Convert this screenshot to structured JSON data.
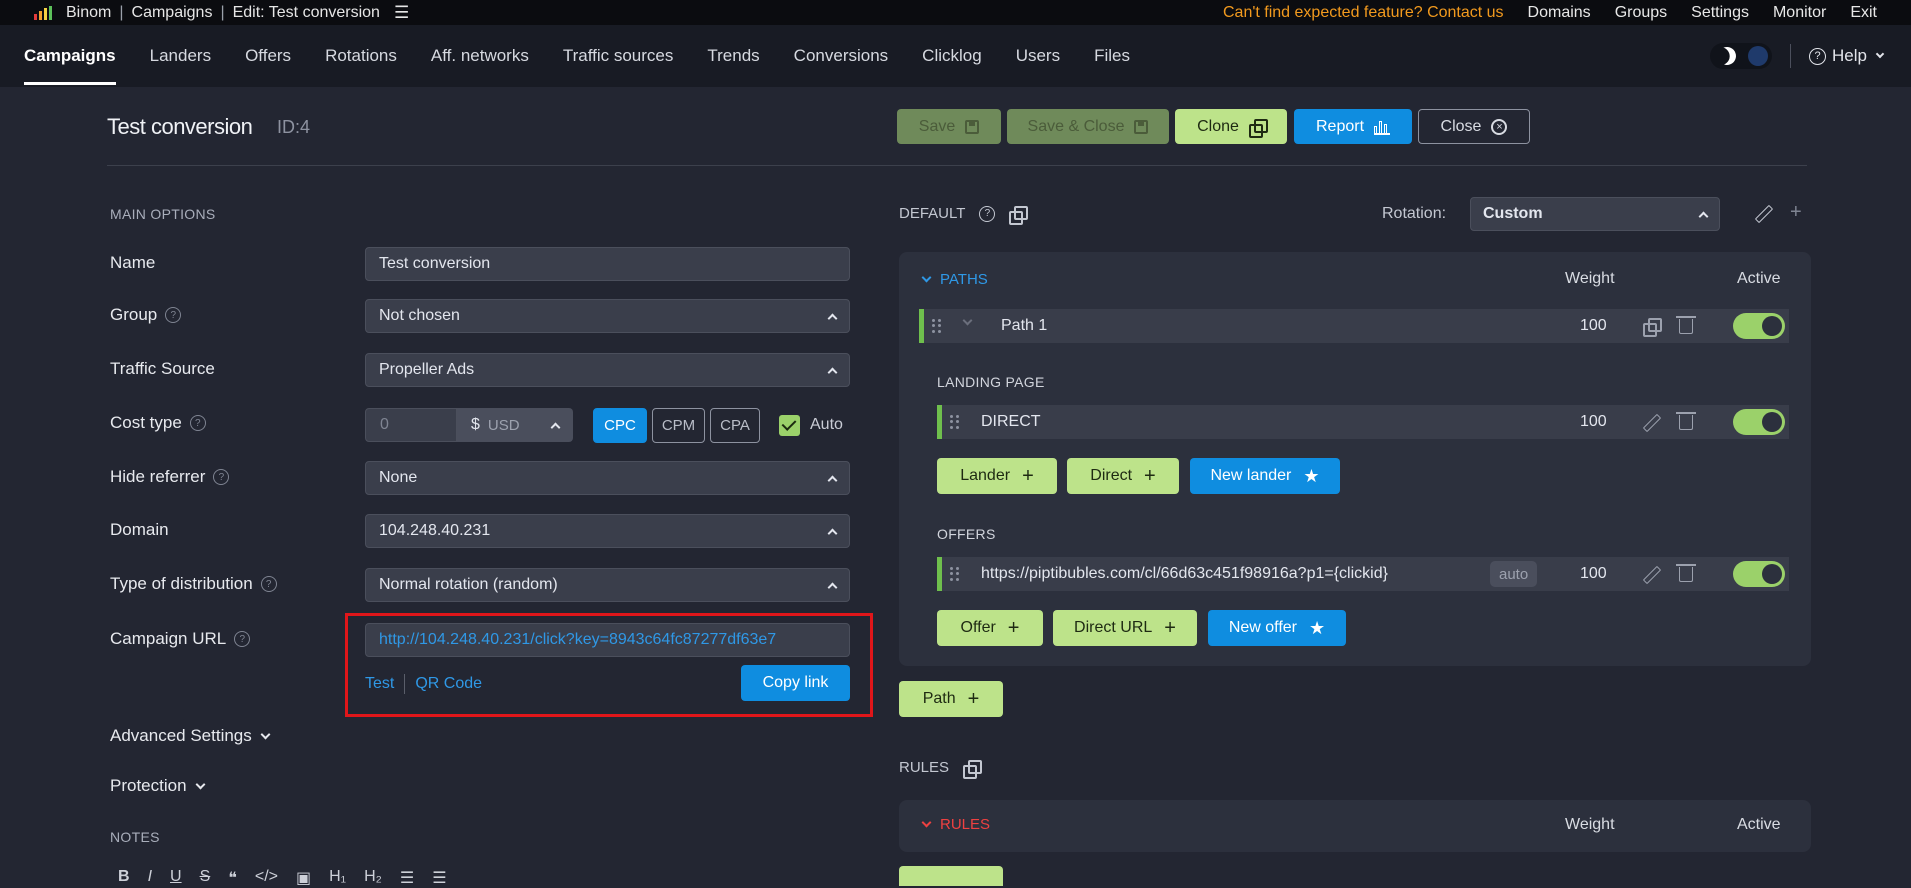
{
  "topbar": {
    "brand": "Binom",
    "crumb_1": "Campaigns",
    "crumb_2": "Edit: Test conversion",
    "contact": "Can't find expected feature? Contact us",
    "links": [
      "Domains",
      "Groups",
      "Settings",
      "Monitor",
      "Exit"
    ]
  },
  "nav": {
    "items": [
      "Campaigns",
      "Landers",
      "Offers",
      "Rotations",
      "Aff. networks",
      "Traffic sources",
      "Trends",
      "Conversions",
      "Clicklog",
      "Users",
      "Files"
    ],
    "help": "Help"
  },
  "page": {
    "title": "Test conversion",
    "id": "ID:4"
  },
  "actions": {
    "save": "Save",
    "save_close": "Save & Close",
    "clone": "Clone",
    "report": "Report",
    "close": "Close"
  },
  "main_options": {
    "heading": "MAIN OPTIONS",
    "name_label": "Name",
    "name_value": "Test conversion",
    "group_label": "Group",
    "group_value": "Not chosen",
    "traffic_label": "Traffic Source",
    "traffic_value": "Propeller Ads",
    "cost_label": "Cost type",
    "cost_value": "0",
    "currency_symbol": "$",
    "currency": "USD",
    "cost_models": [
      "CPC",
      "CPM",
      "CPA"
    ],
    "auto_label": "Auto",
    "referrer_label": "Hide referrer",
    "referrer_value": "None",
    "domain_label": "Domain",
    "domain_value": "104.248.40.231",
    "distribution_label": "Type of distribution",
    "distribution_value": "Normal rotation (random)",
    "url_label": "Campaign URL",
    "url_value": "http://104.248.40.231/click?key=8943c64fc87277df63e7",
    "test_link": "Test",
    "qr_link": "QR Code",
    "copy_link": "Copy link",
    "advanced": "Advanced Settings",
    "protection": "Protection",
    "notes": "NOTES"
  },
  "default_section": {
    "heading": "DEFAULT",
    "rotation_label": "Rotation:",
    "rotation_value": "Custom",
    "paths_heading": "PATHS",
    "weight_col": "Weight",
    "active_col": "Active",
    "path_name": "Path 1",
    "path_weight": "100",
    "landing_heading": "LANDING PAGE",
    "landing_name": "DIRECT",
    "landing_weight": "100",
    "lander_btn": "Lander",
    "direct_btn": "Direct",
    "new_lander_btn": "New lander",
    "offers_heading": "OFFERS",
    "offer_url": "https://piptibubles.com/cl/66d63c451f98916a?p1={clickid}",
    "offer_auto": "auto",
    "offer_weight": "100",
    "offer_btn": "Offer",
    "direct_url_btn": "Direct URL",
    "new_offer_btn": "New offer",
    "path_btn": "Path"
  },
  "rules_section": {
    "heading": "RULES",
    "rules_heading": "RULES",
    "weight_col": "Weight",
    "active_col": "Active"
  },
  "colors": {
    "accent_blue": "#0f8de0",
    "accent_green": "#bde38a",
    "highlight_red": "#e0161a",
    "contact_orange": "#f29a1e"
  }
}
